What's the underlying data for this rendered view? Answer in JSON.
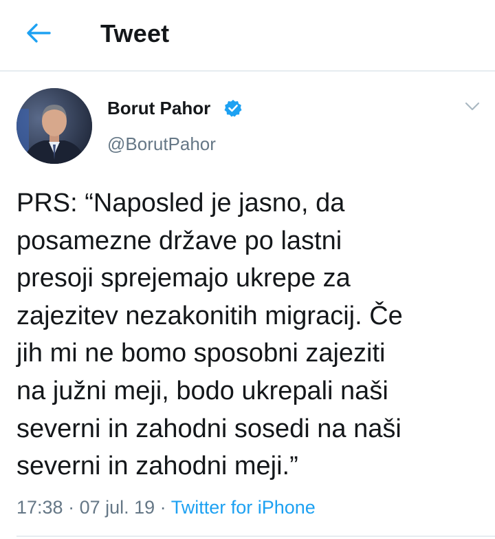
{
  "header": {
    "back_icon": "back-arrow-icon",
    "title": "Tweet"
  },
  "colors": {
    "accent": "#1da1f2",
    "text_primary": "#14171a",
    "text_secondary": "#657786",
    "divider": "#e6ecf0"
  },
  "tweet": {
    "author": {
      "display_name": "Borut Pahor",
      "verified_icon": "verified-badge-icon",
      "handle": "@BorutPahor",
      "avatar_icon": "avatar-photo"
    },
    "more_icon": "chevron-down-icon",
    "text_lines": [
      "PRS: “Naposled je jasno, da",
      "posamezne države po lastni",
      "presoji sprejemajo ukrepe za",
      "zajezitev nezakonitih migracij. Če",
      "jih mi ne bomo sposobni zajeziti",
      "na južni meji, bodo ukrepali naši",
      "severni in zahodni sosedi na naši",
      "severni in zahodni meji.”"
    ],
    "time": "17:38",
    "separator_1": " · ",
    "date": "07 jul. 19",
    "separator_2": " · ",
    "source": "Twitter for iPhone"
  }
}
